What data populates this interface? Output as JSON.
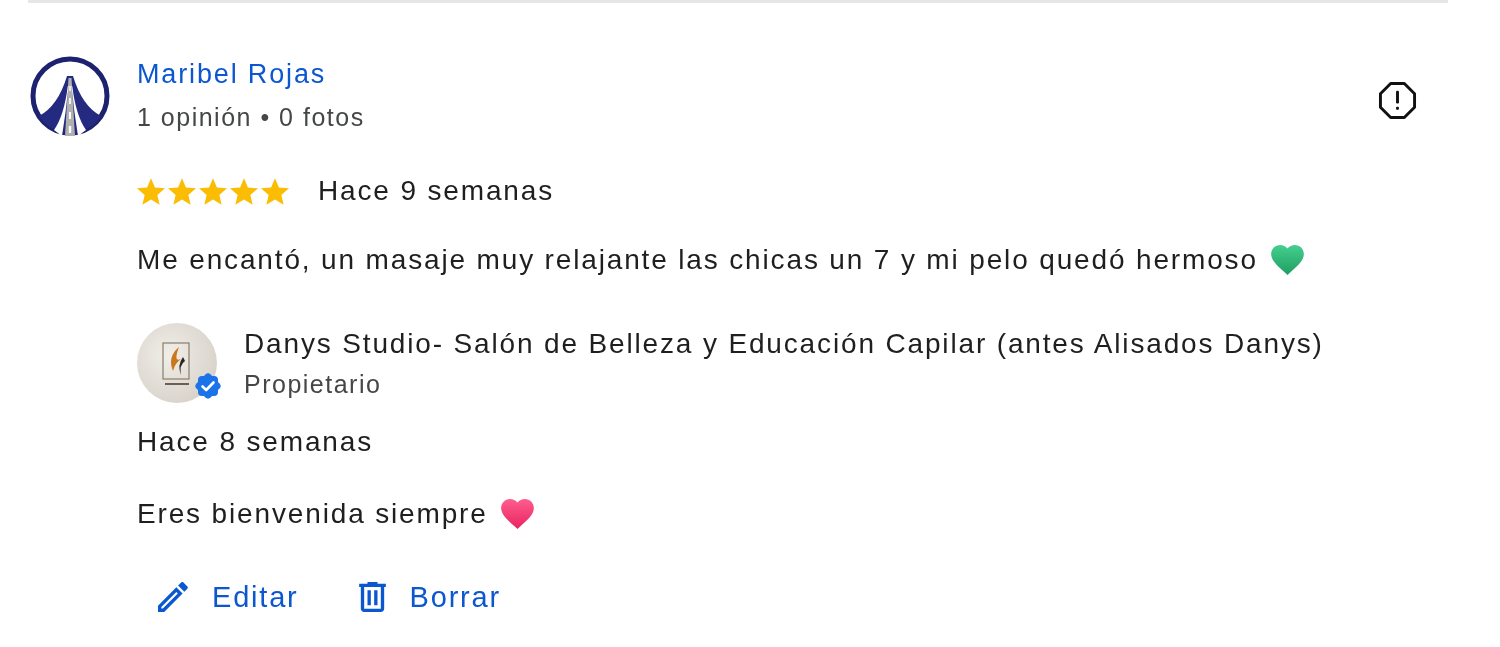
{
  "reviewer": {
    "name": "Maribel Rojas",
    "stats": "1 opinión • 0 fotos"
  },
  "review": {
    "stars": 5,
    "time": "Hace 9 semanas",
    "text": "Me encantó, un masaje muy relajante las chicas un 7 y mi pelo quedó hermoso"
  },
  "owner_reply": {
    "name": "Danys Studio- Salón de Belleza y Educación Capilar (antes Alisados Danys)",
    "role": "Propietario",
    "verified": true,
    "time": "Hace 8 semanas",
    "text": "Eres bienvenida siempre"
  },
  "actions": [
    {
      "label": "Editar",
      "kind": "edit"
    },
    {
      "label": "Borrar",
      "kind": "delete"
    }
  ]
}
